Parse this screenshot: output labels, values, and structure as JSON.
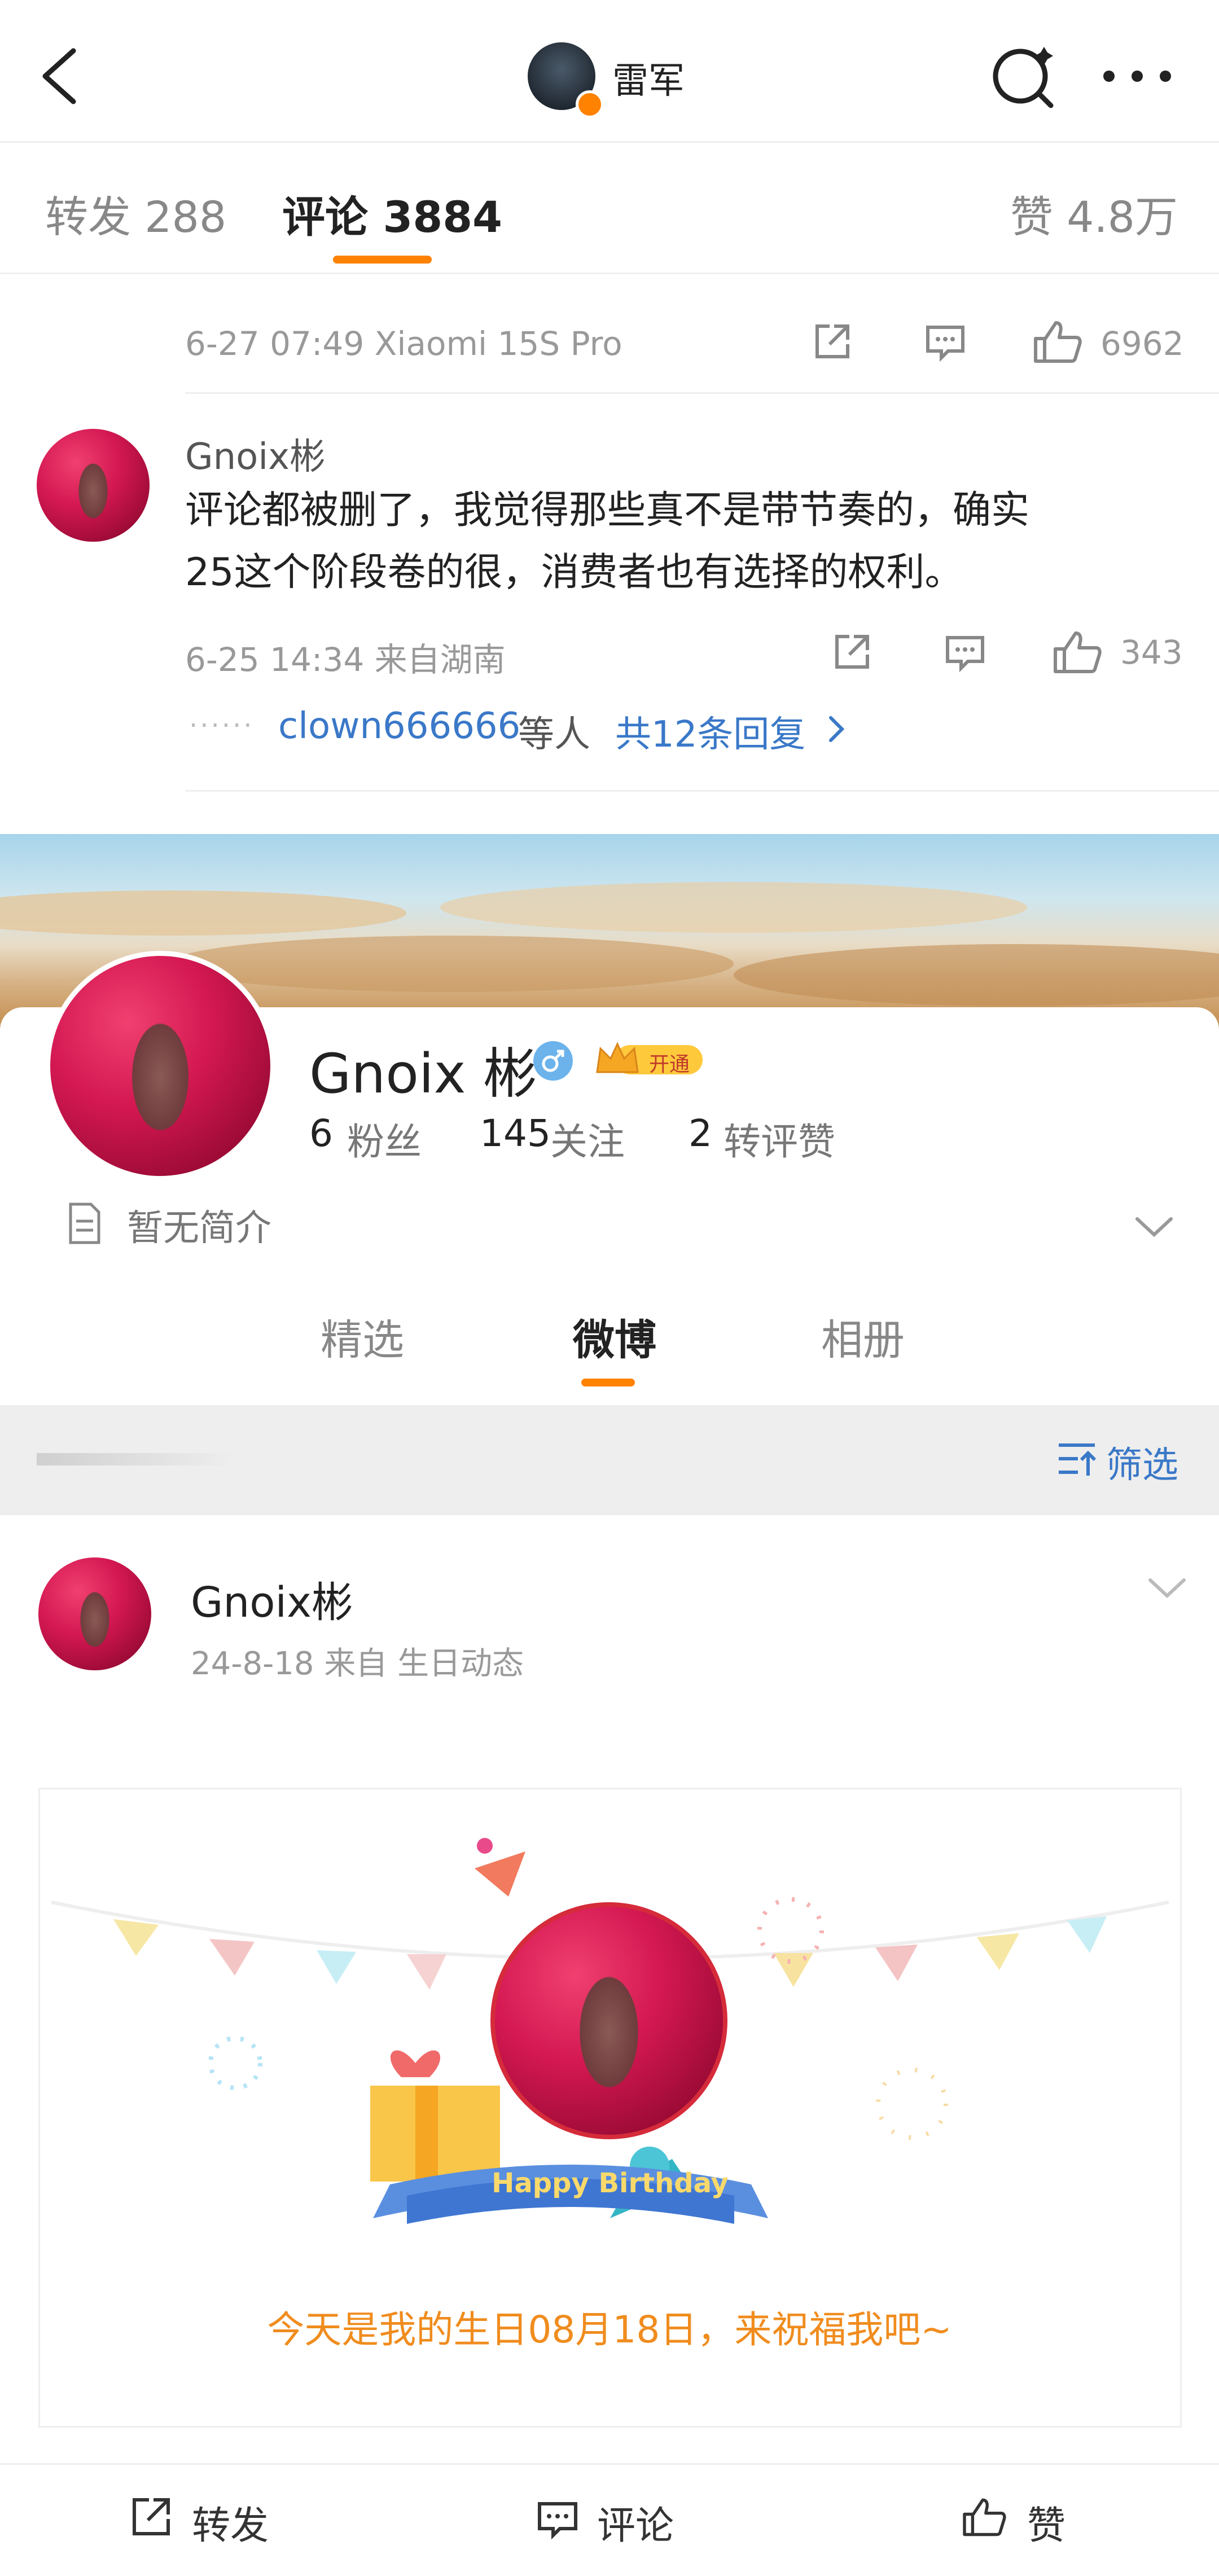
{
  "nav": {
    "title": "雷军",
    "back_icon": "back-arrow-icon",
    "search_icon": "refresh-search-icon",
    "more_icon": "more-dots-icon"
  },
  "tabs": {
    "forward": "转发 288",
    "comment": "评论 3884",
    "like": "赞 4.8万"
  },
  "top_comment_meta": {
    "time_device": "6-27 07:49  Xiaomi 15S Pro",
    "like_count": "6962"
  },
  "comment": {
    "username": "Gnoix彬",
    "text_line1": "评论都被删了，我觉得那些真不是带节奏的，确实",
    "text_line2": "25这个阶段卷的很，消费者也有选择的权利。",
    "time_location": "6-25 14:34  来自湖南",
    "like_count": "343",
    "reply_dots": "······",
    "reply_users": "clown666666",
    "reply_suffix": "等人",
    "reply_count": "共12条回复"
  },
  "profile": {
    "name": "Gnoix 彬",
    "vip_label": "开通",
    "fans_num": "6",
    "fans_label": "粉丝",
    "follow_num": "145",
    "follow_label": "关注",
    "repost_num": "2",
    "repost_label": "转评赞",
    "intro": "暂无简介",
    "tabs": [
      "精选",
      "微博",
      "相册"
    ],
    "filter_label": "筛选"
  },
  "post": {
    "username": "Gnoix彬",
    "meta": "24-8-18   来自 生日动态",
    "banner_text": "Happy Birthday",
    "birthday_text": "今天是我的生日08月18日，来祝福我吧~"
  },
  "bottom_bar": {
    "forward": "转发",
    "comment": "评论",
    "like": "赞"
  },
  "colors": {
    "accent": "#ff8200",
    "link": "#3a78c8",
    "birthday_text": "#f08c1e"
  }
}
